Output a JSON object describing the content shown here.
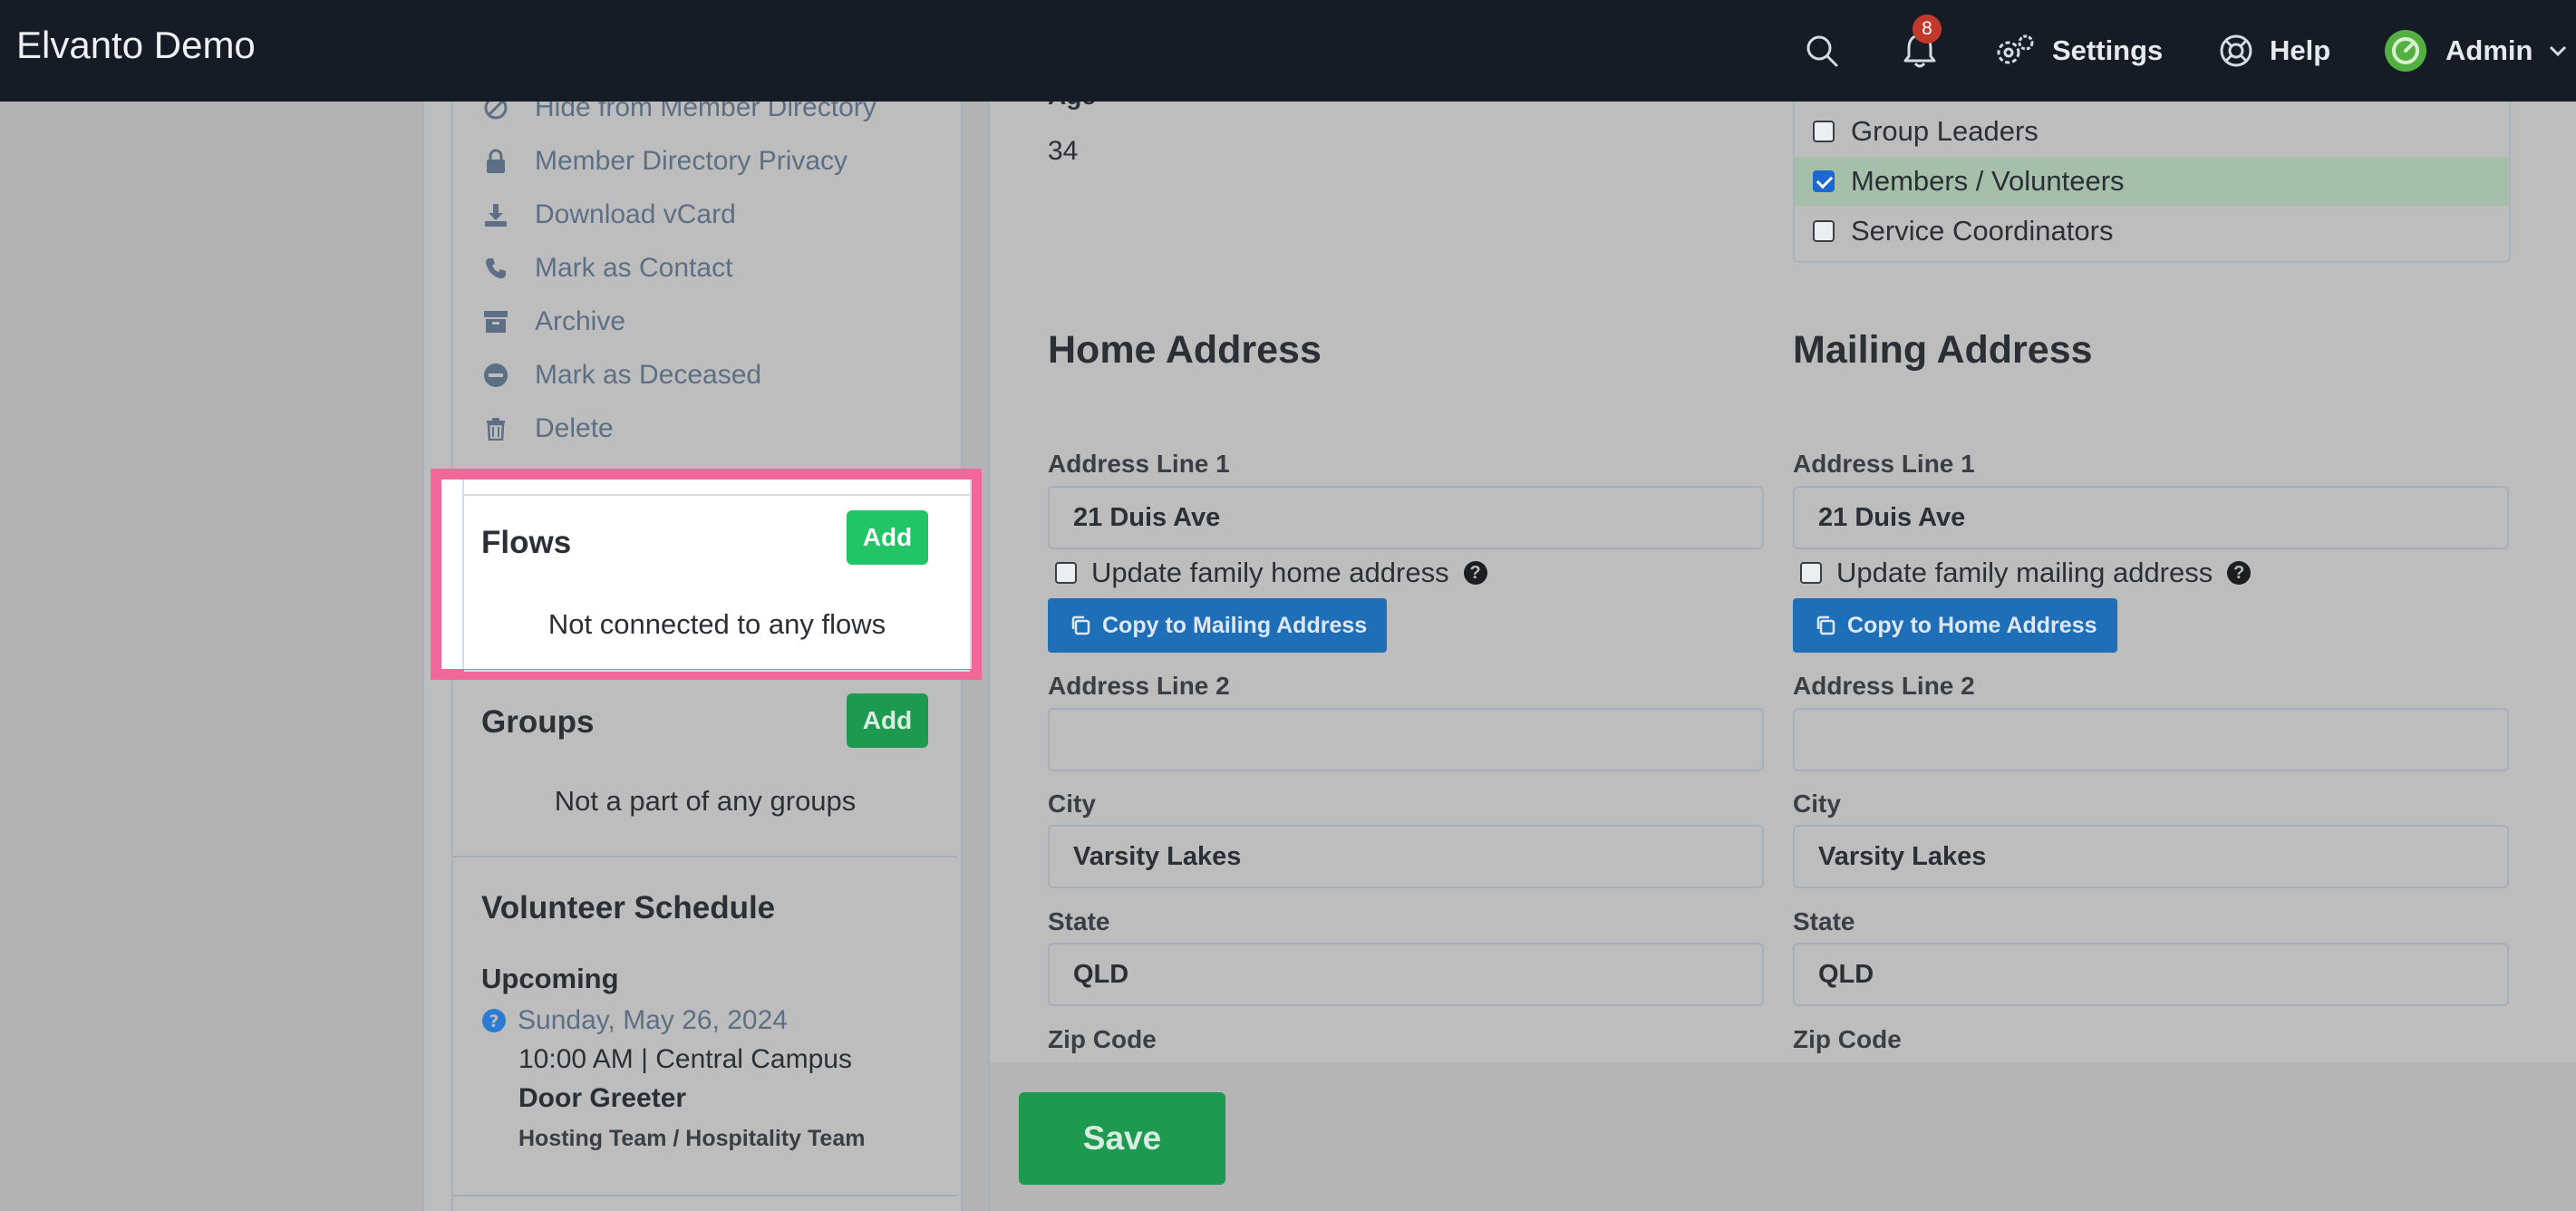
{
  "app": {
    "title": "Elvanto Demo"
  },
  "navbar": {
    "notifications_count": "8",
    "settings_label": "Settings",
    "help_label": "Help",
    "user_label": "Admin"
  },
  "sidebar": {
    "actions": [
      {
        "label": "Hide from Member Directory",
        "icon": "hide-icon"
      },
      {
        "label": "Member Directory Privacy",
        "icon": "lock-icon"
      },
      {
        "label": "Download vCard",
        "icon": "download-icon"
      },
      {
        "label": "Mark as Contact",
        "icon": "phone-icon"
      },
      {
        "label": "Archive",
        "icon": "archive-icon"
      },
      {
        "label": "Mark as Deceased",
        "icon": "minus-circle-icon"
      },
      {
        "label": "Delete",
        "icon": "trash-icon"
      }
    ],
    "flows": {
      "title": "Flows",
      "add_label": "Add",
      "empty_text": "Not connected to any flows"
    },
    "groups": {
      "title": "Groups",
      "add_label": "Add",
      "empty_text": "Not a part of any groups"
    },
    "schedule": {
      "title": "Volunteer Schedule",
      "subtitle": "Upcoming",
      "date": "Sunday, May 26, 2024",
      "time_location": "10:00 AM | Central Campus",
      "role": "Door Greeter",
      "team": "Hosting Team / Hospitality Team"
    }
  },
  "main": {
    "age_label": "Age",
    "age_value": "34",
    "permissions": [
      {
        "label": "Group Leaders",
        "checked": false
      },
      {
        "label": "Members / Volunteers",
        "checked": true
      },
      {
        "label": "Service Coordinators",
        "checked": false
      }
    ],
    "home": {
      "heading": "Home Address",
      "address1_label": "Address Line 1",
      "address1_value": "21 Duis Ave",
      "update_label": "Update family home address",
      "copy_label": "Copy to Mailing Address",
      "address2_label": "Address Line 2",
      "address2_value": "",
      "city_label": "City",
      "city_value": "Varsity Lakes",
      "state_label": "State",
      "state_value": "QLD",
      "zip_label": "Zip Code"
    },
    "mailing": {
      "heading": "Mailing Address",
      "address1_label": "Address Line 1",
      "address1_value": "21 Duis Ave",
      "update_label": "Update family mailing address",
      "copy_label": "Copy to Home Address",
      "address2_label": "Address Line 2",
      "address2_value": "",
      "city_label": "City",
      "city_value": "Varsity Lakes",
      "state_label": "State",
      "state_value": "QLD",
      "zip_label": "Zip Code"
    },
    "save_label": "Save"
  },
  "colors": {
    "navbar_bg": "#151c26",
    "highlight_border": "#f0689a",
    "add_green": "#22c566",
    "copy_blue": "#1f6fb8",
    "save_green": "#1d9a4f"
  }
}
